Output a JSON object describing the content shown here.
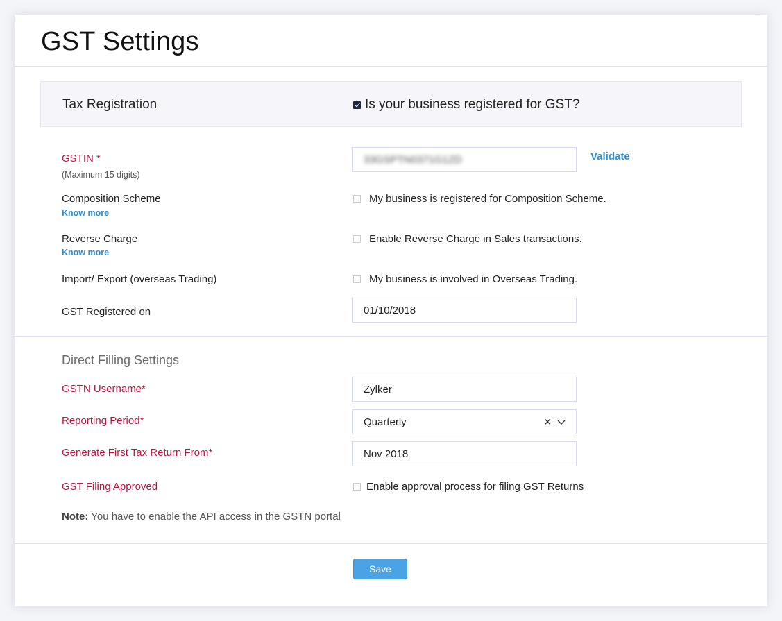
{
  "page": {
    "title": "GST Settings"
  },
  "tax_registration": {
    "label": "Tax Registration",
    "registered_question": "Is your business registered for GST?",
    "registered_checked": true
  },
  "gstin": {
    "label": "GSTIN *",
    "hint": "(Maximum 15 digits)",
    "value": "33GSPTN0371G1ZD",
    "validate_label": "Validate"
  },
  "composition": {
    "label": "Composition Scheme",
    "know_more": "Know more",
    "checkbox_text": "My business is registered for Composition Scheme."
  },
  "reverse_charge": {
    "label": "Reverse Charge",
    "know_more": "Know more",
    "checkbox_text": "Enable Reverse Charge in Sales transactions."
  },
  "import_export": {
    "label": "Import/ Export (overseas Trading)",
    "checkbox_text": "My business is involved in Overseas Trading."
  },
  "registered_on": {
    "label": "GST Registered on",
    "value": "01/10/2018"
  },
  "direct_filing": {
    "title": "Direct Filling Settings",
    "username_label": "GSTN Username*",
    "username_value": "Zylker",
    "period_label": "Reporting Period*",
    "period_value": "Quarterly",
    "first_return_label": "Generate First Tax Return From*",
    "first_return_value": "Nov 2018",
    "approved_label": "GST Filing Approved",
    "approved_checkbox_text": "Enable approval process for filing GST Returns",
    "note_bold": "Note:",
    "note_text": " You have to enable the API access in the GSTN portal"
  },
  "actions": {
    "save_label": "Save"
  },
  "icons": {
    "clear": "clear-icon",
    "dropdown": "chevron-down-icon",
    "check": "check-icon"
  },
  "colors": {
    "required": "#c0143c",
    "link": "#2b8fd6",
    "primary_button": "#4aa3e4"
  }
}
